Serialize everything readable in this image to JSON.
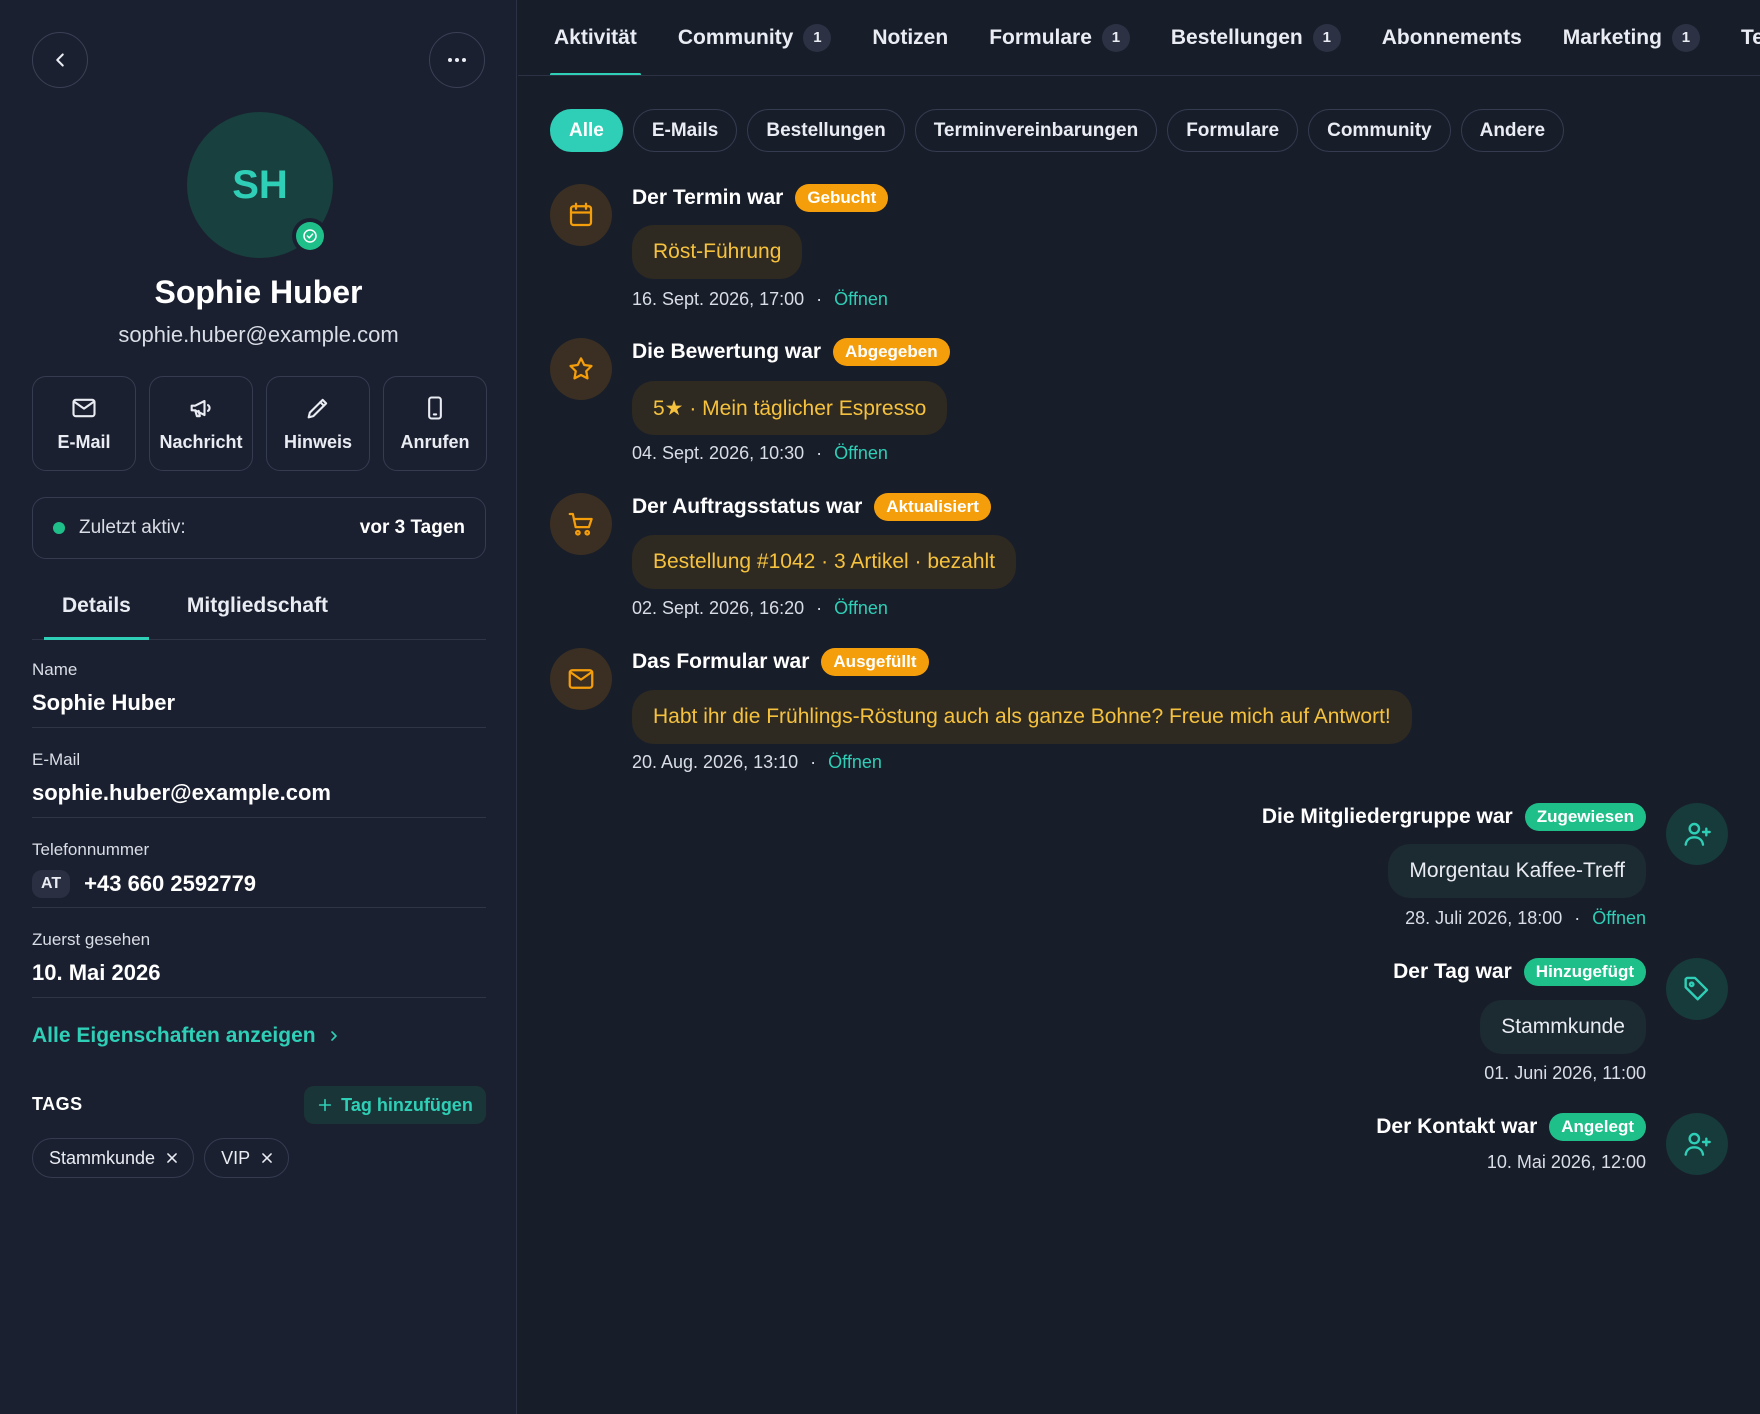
{
  "profile": {
    "initials": "SH",
    "name": "Sophie Huber",
    "email": "sophie.huber@example.com"
  },
  "actions": [
    {
      "label": "E-Mail",
      "icon": "mail-icon"
    },
    {
      "label": "Nachricht",
      "icon": "megaphone-icon"
    },
    {
      "label": "Hinweis",
      "icon": "pencil-icon"
    },
    {
      "label": "Anrufen",
      "icon": "phone-icon"
    }
  ],
  "last_active": {
    "label": "Zuletzt aktiv:",
    "value": "vor 3 Tagen"
  },
  "detail_tabs": [
    "Details",
    "Mitgliedschaft"
  ],
  "fields": {
    "name": {
      "label": "Name",
      "value": "Sophie Huber"
    },
    "email": {
      "label": "E-Mail",
      "value": "sophie.huber@example.com"
    },
    "phone": {
      "label": "Telefonnummer",
      "country": "AT",
      "value": "+43 660 2592779"
    },
    "first_seen": {
      "label": "Zuerst gesehen",
      "value": "10. Mai 2026"
    }
  },
  "show_all_label": "Alle Eigenschaften anzeigen",
  "tags": {
    "title": "TAGS",
    "add_label": "Tag hinzufügen",
    "items": [
      "Stammkunde",
      "VIP"
    ]
  },
  "nav_tabs": [
    {
      "label": "Aktivität",
      "count": ""
    },
    {
      "label": "Community",
      "count": "1"
    },
    {
      "label": "Notizen",
      "count": ""
    },
    {
      "label": "Formulare",
      "count": "1"
    },
    {
      "label": "Bestellungen",
      "count": "1"
    },
    {
      "label": "Abonnements",
      "count": ""
    },
    {
      "label": "Marketing",
      "count": "1"
    },
    {
      "label": "Te",
      "count": ""
    }
  ],
  "filters": [
    "Alle",
    "E-Mails",
    "Bestellungen",
    "Terminvereinbarungen",
    "Formulare",
    "Community",
    "Andere"
  ],
  "open_label": "Öffnen",
  "events": [
    {
      "title": "Der Termin war",
      "badge": "Gebucht",
      "content": "Röst-Führung",
      "time": "16. Sept. 2026, 17:00",
      "icon": "calendar-icon"
    },
    {
      "title": "Die Bewertung war",
      "badge": "Abgegeben",
      "content": "5★ · Mein täglicher Espresso",
      "time": "04. Sept. 2026, 10:30",
      "icon": "star-icon"
    },
    {
      "title": "Der Auftragsstatus war",
      "badge": "Aktualisiert",
      "content": "Bestellung #1042 · 3 Artikel · bezahlt",
      "time": "02. Sept. 2026, 16:20",
      "icon": "cart-icon"
    },
    {
      "title": "Das Formular war",
      "badge": "Ausgefüllt",
      "content": "Habt ihr die Frühlings-Röstung auch als ganze Bohne? Freue mich auf Antwort!",
      "time": "20. Aug. 2026, 13:10",
      "icon": "mail-icon"
    },
    {
      "title": "Die Mitgliedergruppe war",
      "badge": "Zugewiesen",
      "content": "Morgentau Kaffee-Treff",
      "time": "28. Juli 2026, 18:00",
      "icon": "user-plus-icon"
    },
    {
      "title": "Der Tag war",
      "badge": "Hinzugefügt",
      "content": "Stammkunde",
      "time": "01. Juni 2026, 11:00",
      "icon": "tag-icon"
    },
    {
      "title": "Der Kontakt war",
      "badge": "Angelegt",
      "content": "",
      "time": "10. Mai 2026, 12:00",
      "icon": "user-plus-icon"
    }
  ],
  "colors": {
    "accent": "#2ecfb6",
    "orange": "#f59e0b",
    "green": "#1fbf8a",
    "background": "#181d2a"
  }
}
